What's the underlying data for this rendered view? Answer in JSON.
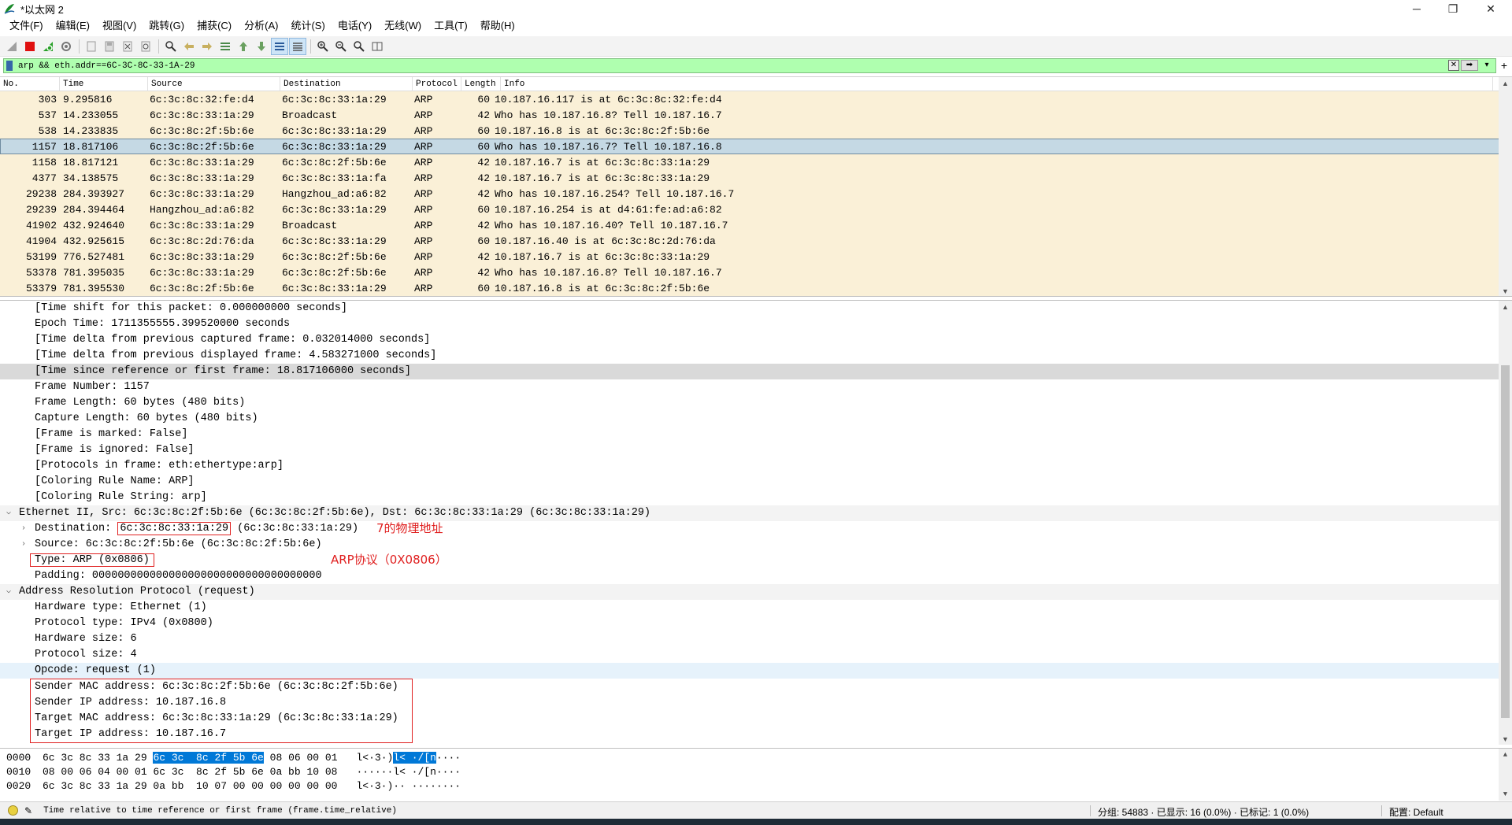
{
  "window": {
    "title": "*以太网 2",
    "minimize": "─",
    "restore": "❐",
    "close": "✕"
  },
  "menu": [
    "文件(F)",
    "编辑(E)",
    "视图(V)",
    "跳转(G)",
    "捕获(C)",
    "分析(A)",
    "统计(S)",
    "电话(Y)",
    "无线(W)",
    "工具(T)",
    "帮助(H)"
  ],
  "filter": {
    "value": "arp && eth.addr==6C-3C-8C-33-1A-29",
    "clear_icon": "x-square-icon",
    "apply_icon": "arrow-right-icon",
    "dropdown": "▾",
    "add": "+"
  },
  "packet_list": {
    "columns": [
      "No.",
      "Time",
      "Source",
      "Destination",
      "Protocol",
      "Length",
      "Info"
    ],
    "rows": [
      {
        "no": "303",
        "time": "9.295816",
        "src": "6c:3c:8c:32:fe:d4",
        "dst": "6c:3c:8c:33:1a:29",
        "proto": "ARP",
        "len": "60",
        "info": "10.187.16.117 is at 6c:3c:8c:32:fe:d4"
      },
      {
        "no": "537",
        "time": "14.233055",
        "src": "6c:3c:8c:33:1a:29",
        "dst": "Broadcast",
        "proto": "ARP",
        "len": "42",
        "info": "Who has 10.187.16.8? Tell 10.187.16.7"
      },
      {
        "no": "538",
        "time": "14.233835",
        "src": "6c:3c:8c:2f:5b:6e",
        "dst": "6c:3c:8c:33:1a:29",
        "proto": "ARP",
        "len": "60",
        "info": "10.187.16.8 is at 6c:3c:8c:2f:5b:6e"
      },
      {
        "no": "1157",
        "time": "18.817106",
        "src": "6c:3c:8c:2f:5b:6e",
        "dst": "6c:3c:8c:33:1a:29",
        "proto": "ARP",
        "len": "60",
        "info": "Who has 10.187.16.7? Tell 10.187.16.8",
        "selected": true
      },
      {
        "no": "1158",
        "time": "18.817121",
        "src": "6c:3c:8c:33:1a:29",
        "dst": "6c:3c:8c:2f:5b:6e",
        "proto": "ARP",
        "len": "42",
        "info": "10.187.16.7 is at 6c:3c:8c:33:1a:29"
      },
      {
        "no": "4377",
        "time": "34.138575",
        "src": "6c:3c:8c:33:1a:29",
        "dst": "6c:3c:8c:33:1a:fa",
        "proto": "ARP",
        "len": "42",
        "info": "10.187.16.7 is at 6c:3c:8c:33:1a:29"
      },
      {
        "no": "29238",
        "time": "284.393927",
        "src": "6c:3c:8c:33:1a:29",
        "dst": "Hangzhou_ad:a6:82",
        "proto": "ARP",
        "len": "42",
        "info": "Who has 10.187.16.254? Tell 10.187.16.7"
      },
      {
        "no": "29239",
        "time": "284.394464",
        "src": "Hangzhou_ad:a6:82",
        "dst": "6c:3c:8c:33:1a:29",
        "proto": "ARP",
        "len": "60",
        "info": "10.187.16.254 is at d4:61:fe:ad:a6:82"
      },
      {
        "no": "41902",
        "time": "432.924640",
        "src": "6c:3c:8c:33:1a:29",
        "dst": "Broadcast",
        "proto": "ARP",
        "len": "42",
        "info": "Who has 10.187.16.40? Tell 10.187.16.7"
      },
      {
        "no": "41904",
        "time": "432.925615",
        "src": "6c:3c:8c:2d:76:da",
        "dst": "6c:3c:8c:33:1a:29",
        "proto": "ARP",
        "len": "60",
        "info": "10.187.16.40 is at 6c:3c:8c:2d:76:da"
      },
      {
        "no": "53199",
        "time": "776.527481",
        "src": "6c:3c:8c:33:1a:29",
        "dst": "6c:3c:8c:2f:5b:6e",
        "proto": "ARP",
        "len": "42",
        "info": "10.187.16.7 is at 6c:3c:8c:33:1a:29"
      },
      {
        "no": "53378",
        "time": "781.395035",
        "src": "6c:3c:8c:33:1a:29",
        "dst": "6c:3c:8c:2f:5b:6e",
        "proto": "ARP",
        "len": "42",
        "info": "Who has 10.187.16.8? Tell 10.187.16.7"
      },
      {
        "no": "53379",
        "time": "781.395530",
        "src": "6c:3c:8c:2f:5b:6e",
        "dst": "6c:3c:8c:33:1a:29",
        "proto": "ARP",
        "len": "60",
        "info": "10.187.16.8 is at 6c:3c:8c:2f:5b:6e"
      }
    ]
  },
  "details": {
    "frame_lines": [
      "[Time shift for this packet: 0.000000000 seconds]",
      "Epoch Time: 1711355555.399520000 seconds",
      "[Time delta from previous captured frame: 0.032014000 seconds]",
      "[Time delta from previous displayed frame: 4.583271000 seconds]",
      "[Time since reference or first frame: 18.817106000 seconds]",
      "Frame Number: 1157",
      "Frame Length: 60 bytes (480 bits)",
      "Capture Length: 60 bytes (480 bits)",
      "[Frame is marked: False]",
      "[Frame is ignored: False]",
      "[Protocols in frame: eth:ethertype:arp]",
      "[Coloring Rule Name: ARP]",
      "[Coloring Rule String: arp]"
    ],
    "ethernet_header": "Ethernet II, Src: 6c:3c:8c:2f:5b:6e (6c:3c:8c:2f:5b:6e), Dst: 6c:3c:8c:33:1a:29 (6c:3c:8c:33:1a:29)",
    "eth_dest_label": "Destination: ",
    "eth_dest_addr": "6c:3c:8c:33:1a:29",
    "eth_dest_suffix": " (6c:3c:8c:33:1a:29)",
    "eth_source": "Source: 6c:3c:8c:2f:5b:6e (6c:3c:8c:2f:5b:6e)",
    "eth_type": "Type: ARP (0x0806)",
    "eth_padding": "Padding: 000000000000000000000000000000000000",
    "annot_dest": "7的物理地址",
    "annot_type": "ARP协议（0X0806）",
    "arp_header": "Address Resolution Protocol (request)",
    "arp_lines": [
      "Hardware type: Ethernet (1)",
      "Protocol type: IPv4 (0x0800)",
      "Hardware size: 6",
      "Protocol size: 4",
      "Opcode: request (1)"
    ],
    "arp_boxed": [
      "Sender MAC address: 6c:3c:8c:2f:5b:6e (6c:3c:8c:2f:5b:6e)",
      "Sender IP address: 10.187.16.8",
      "Target MAC address: 6c:3c:8c:33:1a:29 (6c:3c:8c:33:1a:29)",
      "Target IP address: 10.187.16.7"
    ]
  },
  "bytes": {
    "rows": [
      {
        "offset": "0000",
        "hex_pre": "6c 3c 8c 33 1a 29 ",
        "hex_hl": "6c 3c  8c 2f 5b 6e",
        "hex_post": " 08 06 00 01",
        "ascii_pre": "l<·3·)",
        "ascii_hl": "l< ·/[n",
        "ascii_post": "····"
      },
      {
        "offset": "0010",
        "hex_pre": "08 00 06 04 00 01 6c 3c  8c 2f 5b 6e 0a bb 10 08",
        "hex_hl": "",
        "hex_post": "",
        "ascii_pre": "······l< ·/[n····",
        "ascii_hl": "",
        "ascii_post": ""
      },
      {
        "offset": "0020",
        "hex_pre": "6c 3c 8c 33 1a 29 0a bb  10 07 00 00 00 00 00 00",
        "hex_hl": "",
        "hex_post": "",
        "ascii_pre": "l<·3·)·· ········",
        "ascii_hl": "",
        "ascii_post": ""
      }
    ]
  },
  "status": {
    "field": "Time relative to time reference or first frame (frame.time_relative)",
    "counts": "分组: 54883 · 已显示: 16 (0.0%) · 已标记: 1 (0.0%)",
    "profile": "配置: Default"
  },
  "colors": {
    "row_bg": "#faf0d7",
    "selected_bg": "#c5d9e4",
    "filter_bg": "#afffaf",
    "annotation": "#e02020",
    "hex_highlight": "#0078d7"
  }
}
